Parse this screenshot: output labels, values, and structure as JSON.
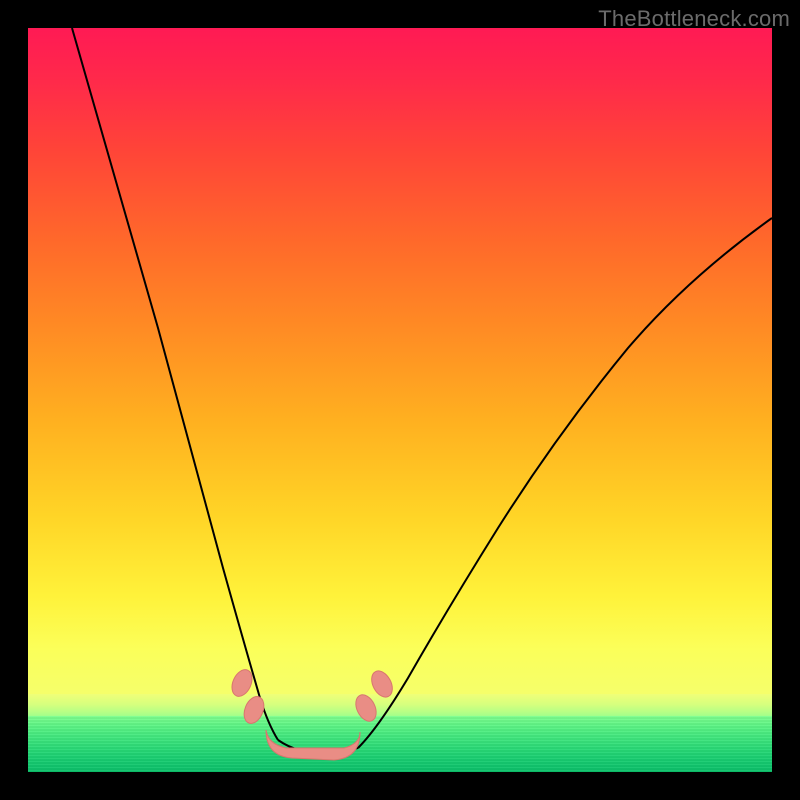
{
  "watermark": {
    "text": "TheBottleneck.com"
  },
  "colors": {
    "gradient_top": "#ff1a54",
    "gradient_mid": "#ffd426",
    "gradient_bottom": "#f4ff6e",
    "green_band_top": "#7dff8e",
    "green_band_bottom": "#0cc06a",
    "curve": "#000000",
    "valley_marker": "#e98d85",
    "frame": "#000000"
  },
  "chart_data": {
    "type": "line",
    "title": "",
    "xlabel": "",
    "ylabel": "",
    "xlim": [
      0,
      100
    ],
    "ylim": [
      0,
      100
    ],
    "grid": false,
    "legend": false,
    "annotations": [
      {
        "kind": "valley-marker",
        "x_range": [
          31,
          41
        ],
        "y": 2
      },
      {
        "kind": "nub",
        "x": 28.5,
        "y": 11
      },
      {
        "kind": "nub",
        "x": 29.8,
        "y": 8
      },
      {
        "kind": "nub",
        "x": 42.5,
        "y": 9
      },
      {
        "kind": "nub",
        "x": 44.5,
        "y": 11
      }
    ],
    "series": [
      {
        "name": "bottleneck-curve",
        "x": [
          0,
          4,
          8,
          12,
          16,
          20,
          24,
          28,
          30,
          32,
          36,
          40,
          42,
          44,
          48,
          54,
          60,
          68,
          76,
          84,
          92,
          100
        ],
        "y": [
          100,
          88,
          76,
          64,
          52,
          40,
          28,
          16,
          10,
          4,
          2,
          4,
          8,
          12,
          22,
          34,
          44,
          54,
          62,
          68,
          72,
          74
        ]
      }
    ],
    "notes": "V-shaped curve; minimum (best match) around x≈34–38. Values estimated from pixel positions; no axis ticks are shown in the source image."
  }
}
